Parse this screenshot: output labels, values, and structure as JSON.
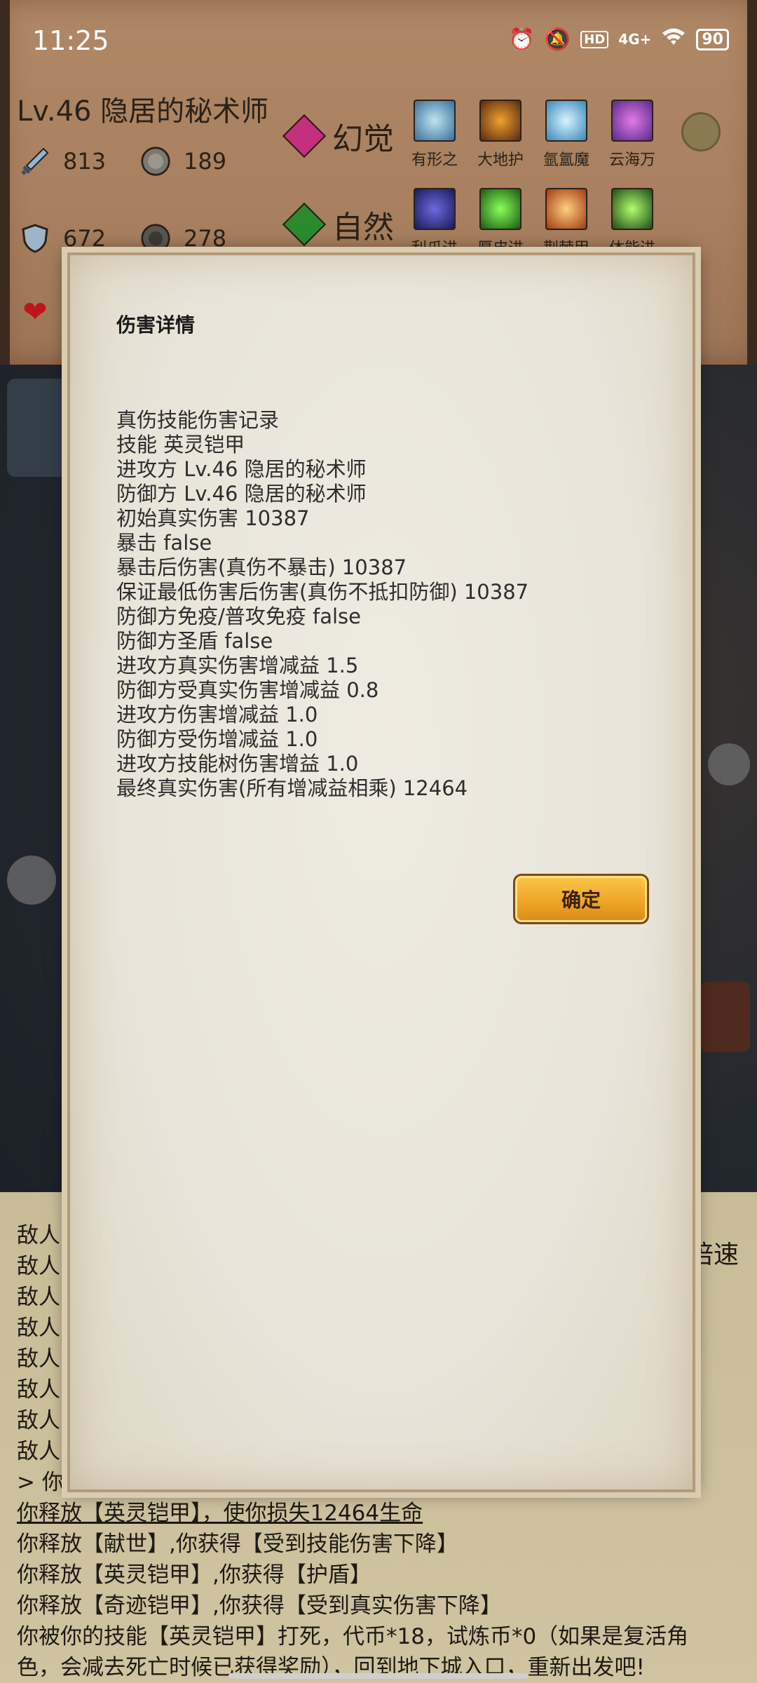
{
  "status_bar": {
    "time": "11:25",
    "icons": [
      "alarm-icon",
      "mute-icon",
      "hd-icon",
      "signal-icon",
      "wifi-icon",
      "battery-icon"
    ],
    "hd": "HD",
    "network": "4G+",
    "battery": "90"
  },
  "character": {
    "title": "Lv.46 隐居的秘术师",
    "stats": {
      "attack": "813",
      "magic_attack": "189",
      "defense": "672",
      "magic_defense": "278"
    }
  },
  "schools": [
    {
      "name": "幻觉",
      "color": "#c4307e",
      "skills": [
        "有形之",
        "大地护",
        "氩氲魔",
        "云海万"
      ]
    },
    {
      "name": "自然",
      "color": "#2c8a2e",
      "skills": [
        "利爪进",
        "厚皮进",
        "荆棘甲",
        "体能进"
      ]
    }
  ],
  "modal": {
    "title": "伤害详情",
    "lines": [
      "真伤技能伤害记录",
      "技能 英灵铠甲",
      "进攻方 Lv.46 隐居的秘术师",
      "防御方 Lv.46 隐居的秘术师",
      "初始真实伤害 10387",
      "暴击 false",
      "暴击后伤害(真伤不暴击) 10387",
      "保证最低伤害后伤害(真伤不抵扣防御) 10387",
      "防御方免疫/普攻免疫 false",
      "防御方圣盾 false",
      "进攻方真实伤害增减益 1.5",
      "防御方受真实伤害增减益 0.8",
      "进攻方伤害增减益 1.0",
      "防御方受伤增减益 1.0",
      "进攻方技能树伤害增益 1.0",
      "最终真实伤害(所有增减益相乘) 12464"
    ],
    "confirm_label": "确定"
  },
  "log": {
    "speed_label": "倍速",
    "enemy_lines": [
      "敌人",
      "敌人",
      "敌人",
      "敌人",
      "敌人",
      "敌人",
      "敌人",
      "敌人"
    ],
    "prompt_line": "> 你的",
    "lines": [
      "你释放【英灵铠甲】，使你损失12464生命",
      "你释放【献世】,你获得【受到技能伤害下降】",
      "你释放【英灵铠甲】,你获得【护盾】",
      "你释放【奇迹铠甲】,你获得【受到真实伤害下降】",
      "你被你的技能【英灵铠甲】打死，代币*18，试炼币*0（如果是复活角",
      "色，会减去死亡时候已获得奖励），回到地下城入口，重新出发吧!"
    ]
  }
}
